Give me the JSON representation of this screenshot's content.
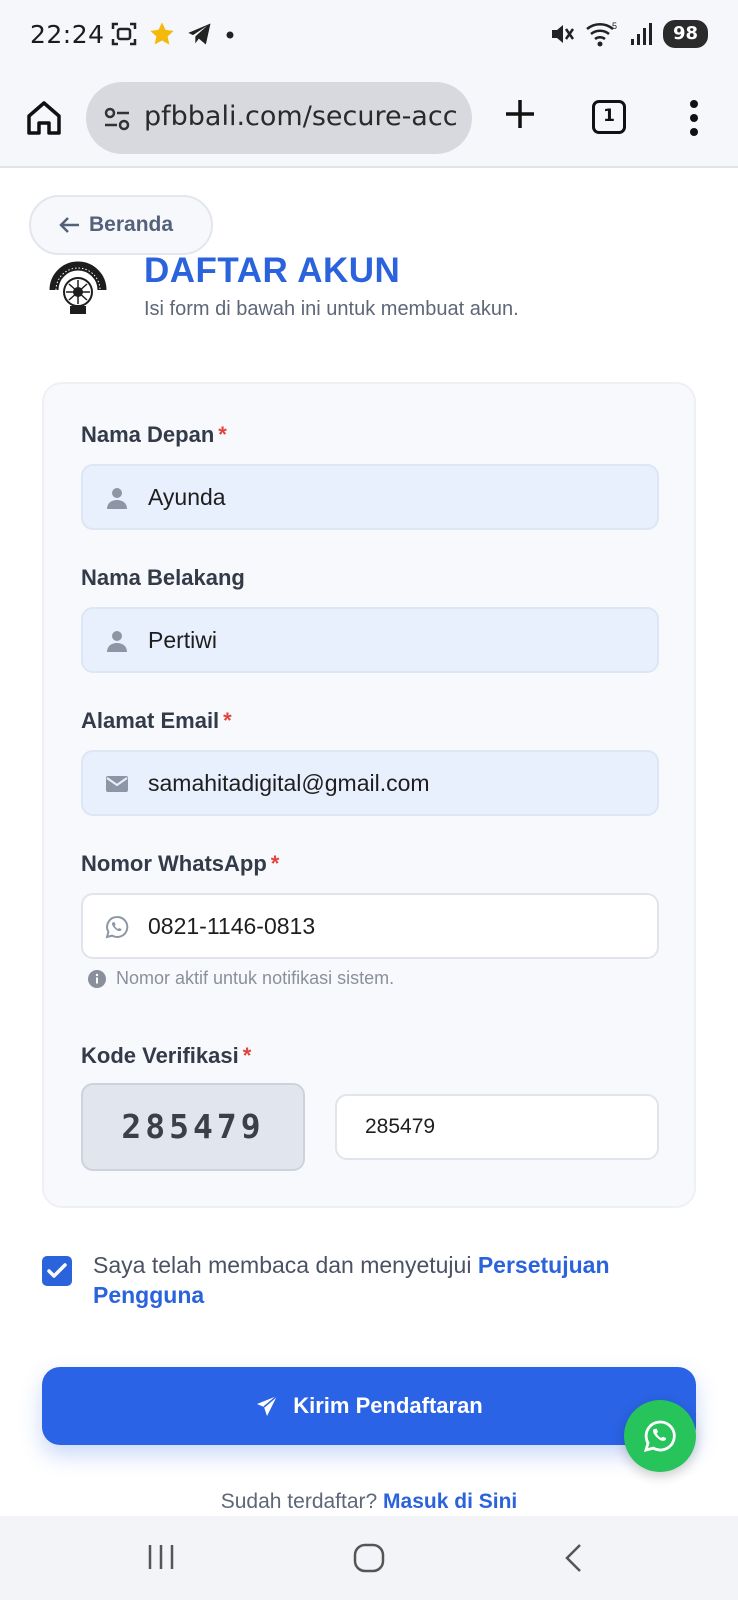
{
  "status_bar": {
    "time": "22:24",
    "battery": "98",
    "left_icons": [
      "screenshot-icon",
      "star-icon",
      "telegram-icon",
      "dot-icon"
    ],
    "right_icons": [
      "mute-icon",
      "wifi-icon",
      "signal-icon"
    ],
    "star_color": "#f5b90b"
  },
  "browser": {
    "url": "pfbbali.com/secure-acc",
    "tab_count": "1"
  },
  "page": {
    "back_label": "Beranda",
    "title": "DAFTAR AKUN",
    "subtitle": "Isi form di bawah ini untuk membuat akun."
  },
  "form": {
    "first_name": {
      "label": "Nama Depan",
      "required": "*",
      "value": "Ayunda"
    },
    "last_name": {
      "label": "Nama Belakang",
      "value": "Pertiwi"
    },
    "email": {
      "label": "Alamat Email",
      "required": "*",
      "value": "samahitadigital@gmail.com"
    },
    "whatsapp": {
      "label": "Nomor WhatsApp",
      "required": "*",
      "value": "0821-1146-0813",
      "hint": "Nomor aktif untuk notifikasi sistem."
    },
    "verification": {
      "label": "Kode Verifikasi",
      "required": "*",
      "code": "285479",
      "value": "285479"
    }
  },
  "agreement": {
    "checked": true,
    "text": "Saya telah membaca dan menyetujui",
    "link": "Persetujuan Pengguna"
  },
  "submit_label": "Kirim Pendaftaran",
  "login": {
    "text": "Sudah terdaftar?",
    "link": "Masuk di Sini"
  },
  "colors": {
    "primary": "#2b63dd",
    "required": "#e0453c",
    "whatsapp": "#27c35b"
  }
}
